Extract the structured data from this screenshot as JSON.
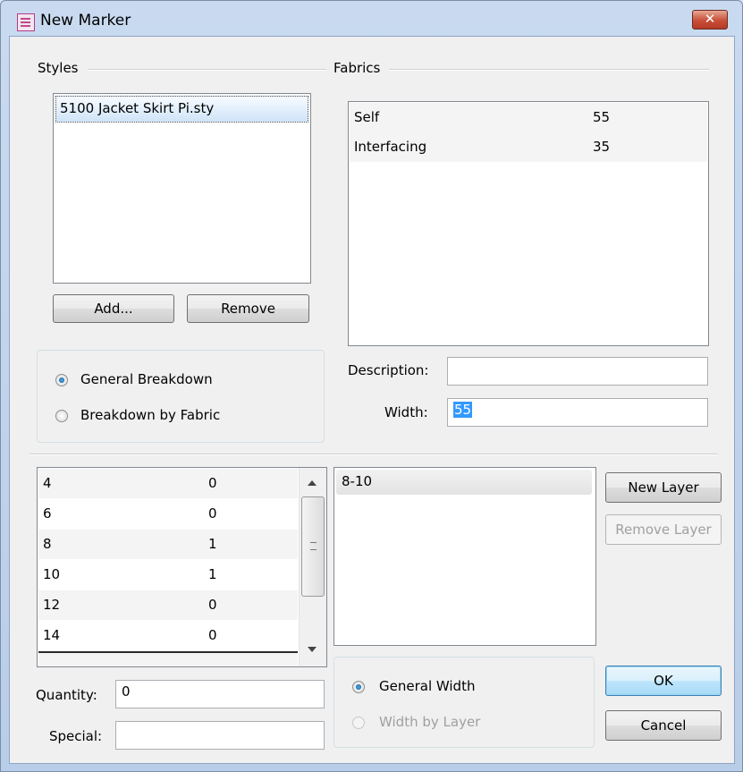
{
  "window": {
    "title": "New Marker",
    "close_glyph": "✕"
  },
  "styles": {
    "label": "Styles",
    "items": [
      "5100 Jacket Skirt Pi.sty"
    ],
    "add_label": "Add...",
    "remove_label": "Remove"
  },
  "fabrics": {
    "label": "Fabrics",
    "rows": [
      {
        "name": "Self",
        "value": "55"
      },
      {
        "name": "Interfacing",
        "value": "35"
      }
    ],
    "description_label": "Description:",
    "description_value": "",
    "width_label": "Width:",
    "width_value": "55"
  },
  "breakdown": {
    "options": [
      "General Breakdown",
      "Breakdown by Fabric"
    ],
    "selected": "General Breakdown"
  },
  "sizes": {
    "rows": [
      {
        "size": "4",
        "qty": "0"
      },
      {
        "size": "6",
        "qty": "0"
      },
      {
        "size": "8",
        "qty": "1"
      },
      {
        "size": "10",
        "qty": "1"
      },
      {
        "size": "12",
        "qty": "0"
      },
      {
        "size": "14",
        "qty": "0"
      }
    ],
    "quantity_label": "Quantity:",
    "quantity_value": "0",
    "special_label": "Special:",
    "special_value": ""
  },
  "layers": {
    "items": [
      "8-10"
    ],
    "new_layer_label": "New Layer",
    "remove_layer_label": "Remove Layer"
  },
  "width_mode": {
    "options": [
      "General Width",
      "Width by Layer"
    ],
    "selected": "General Width"
  },
  "actions": {
    "ok_label": "OK",
    "cancel_label": "Cancel"
  },
  "colors": {
    "selection": "#3399ff",
    "close_button": "#c84e37",
    "title_bar": "#c9daf0"
  }
}
